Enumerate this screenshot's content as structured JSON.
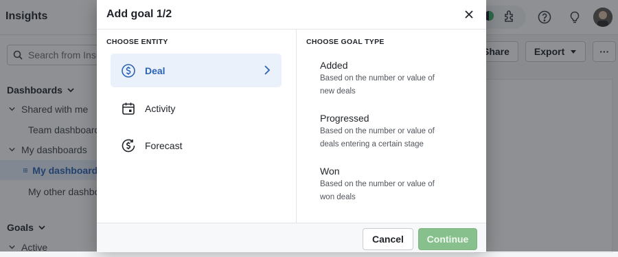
{
  "app": {
    "title": "Insights"
  },
  "sidebar": {
    "search_placeholder": "Search from Insights",
    "sections": [
      {
        "label": "Dashboards"
      },
      {
        "label": "Goals"
      }
    ],
    "groups": [
      {
        "label": "Shared with me"
      },
      {
        "label": "My dashboards"
      },
      {
        "label": "Active"
      }
    ],
    "items": [
      {
        "label": "Team dashboards"
      },
      {
        "label": "My dashboards"
      },
      {
        "label": "My other dashboards"
      }
    ]
  },
  "toolbar": {
    "share_label": "Share",
    "export_label": "Export",
    "more_label": "···"
  },
  "modal": {
    "title": "Add goal 1/2",
    "entity_heading": "CHOOSE ENTITY",
    "goal_heading": "CHOOSE GOAL TYPE",
    "entities": [
      {
        "label": "Deal",
        "icon": "dollar-circle-icon"
      },
      {
        "label": "Activity",
        "icon": "calendar-icon"
      },
      {
        "label": "Forecast",
        "icon": "forecast-icon"
      }
    ],
    "goal_types": [
      {
        "name": "Added",
        "desc": "Based on the number or value of new deals"
      },
      {
        "name": "Progressed",
        "desc": "Based on the number or value of deals entering a certain stage"
      },
      {
        "name": "Won",
        "desc": "Based on the number or value of won deals"
      }
    ],
    "cancel_label": "Cancel",
    "continue_label": "Continue"
  },
  "colors": {
    "accent": "#2b63b5",
    "active_bg": "#eaf1fb",
    "continue_bg": "#88c08d"
  }
}
